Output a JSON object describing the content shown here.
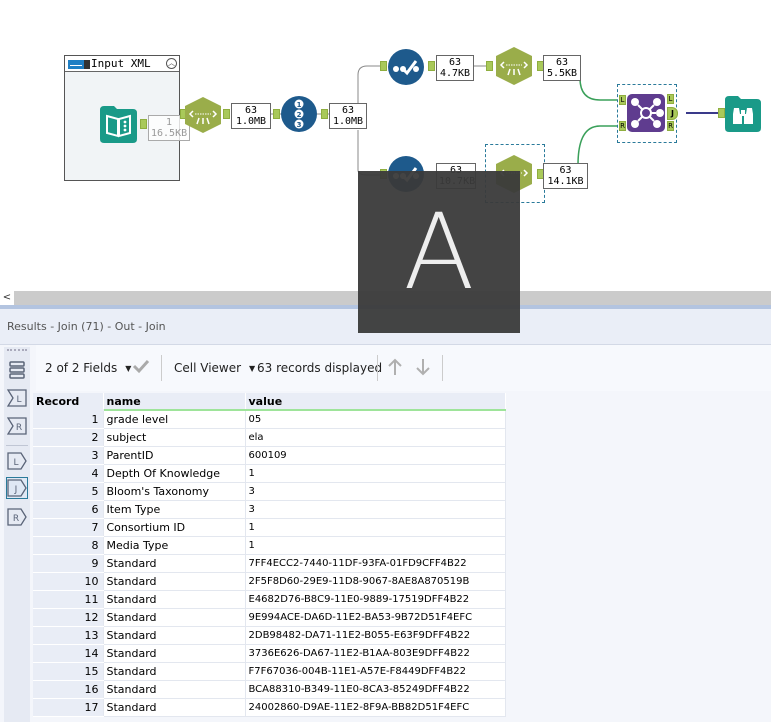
{
  "canvas": {
    "container": {
      "title": "Input XML",
      "collapse_icon": "chevron-up-circle-icon"
    },
    "badges": {
      "input": {
        "count": "1",
        "size": "16.5KB"
      },
      "parse1": {
        "count": "63",
        "size": "1.0MB"
      },
      "record_id": {
        "count": "63",
        "size": "1.0MB"
      },
      "select_top": {
        "count": "63",
        "size": "4.7KB"
      },
      "parse_top": {
        "count": "63",
        "size": "5.5KB"
      },
      "select_bottom": {
        "count": "63",
        "size": "10.7KB"
      },
      "parse_bottom": {
        "count": "63",
        "size": "14.1KB"
      }
    },
    "join_labels": {
      "left_in": "L",
      "right_in": "R",
      "left_out": "L",
      "join_out": "J",
      "right_out": "R"
    },
    "record_id_digits": [
      "1",
      "2",
      "3"
    ],
    "colors": {
      "xml_green": "#9aad4a",
      "tool_blue": "#1e5a8c",
      "join_purple": "#5f3c8f",
      "teal": "#1a9a88",
      "connector": "#3aa05a"
    }
  },
  "scrollbar": {
    "left_arrow": "<"
  },
  "results": {
    "title": "Results - Join (71) - Out - Join",
    "toolbar": {
      "fields_label": "2 of 2 Fields",
      "cell_viewer_label": "Cell Viewer",
      "records_label": "63 records displayed"
    },
    "sidebar": {
      "items": [
        {
          "icon": "table-icon",
          "label": ""
        },
        {
          "icon": "left-input-icon",
          "label": "L"
        },
        {
          "icon": "right-input-icon",
          "label": "R"
        },
        {
          "icon": "left-output-icon",
          "label": "L"
        },
        {
          "icon": "join-output-icon",
          "label": "J"
        },
        {
          "icon": "right-output-icon",
          "label": "R"
        }
      ]
    },
    "columns": [
      "Record",
      "name",
      "value"
    ],
    "rows": [
      {
        "record": "1",
        "name": "grade level",
        "value": "05"
      },
      {
        "record": "2",
        "name": "subject",
        "value": "ela"
      },
      {
        "record": "3",
        "name": "ParentID",
        "value": "600109"
      },
      {
        "record": "4",
        "name": "Depth Of Knowledge",
        "value": "1"
      },
      {
        "record": "5",
        "name": "Bloom's Taxonomy",
        "value": "3"
      },
      {
        "record": "6",
        "name": "Item Type",
        "value": "3"
      },
      {
        "record": "7",
        "name": "Consortium ID",
        "value": "1"
      },
      {
        "record": "8",
        "name": "Media Type",
        "value": "1"
      },
      {
        "record": "9",
        "name": "Standard",
        "value": "7FF4ECC2-7440-11DF-93FA-01FD9CFF4B22"
      },
      {
        "record": "10",
        "name": "Standard",
        "value": "2F5F8D60-29E9-11D8-9067-8AE8A870519B"
      },
      {
        "record": "11",
        "name": "Standard",
        "value": "E4682D76-B8C9-11E0-9889-17519DFF4B22"
      },
      {
        "record": "12",
        "name": "Standard",
        "value": "9E994ACE-DA6D-11E2-BA53-9B72D51F4EFC"
      },
      {
        "record": "13",
        "name": "Standard",
        "value": "2DB98482-DA71-11E2-B055-E63F9DFF4B22"
      },
      {
        "record": "14",
        "name": "Standard",
        "value": "3736E626-DA67-11E2-B1AA-803E9DFF4B22"
      },
      {
        "record": "15",
        "name": "Standard",
        "value": "F7F67036-004B-11E1-A57E-F8449DFF4B22"
      },
      {
        "record": "16",
        "name": "Standard",
        "value": "BCA88310-B349-11E0-8CA3-85249DFF4B22"
      },
      {
        "record": "17",
        "name": "Standard",
        "value": "24002860-D9AE-11E2-8F9A-BB82D51F4EFC"
      }
    ]
  },
  "overlay": {
    "letter": "A"
  }
}
